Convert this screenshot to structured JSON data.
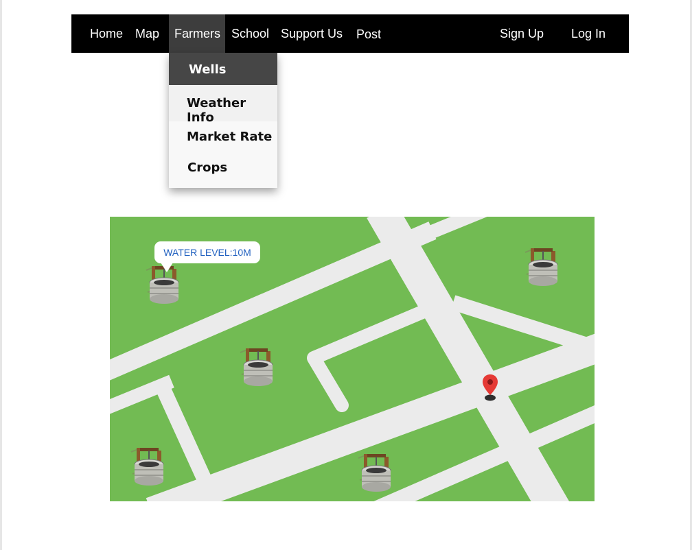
{
  "navbar": {
    "items": [
      {
        "label": "Home"
      },
      {
        "label": "Map"
      },
      {
        "label": "Farmers"
      },
      {
        "label": "School"
      },
      {
        "label": "Support Us"
      },
      {
        "label": "Post"
      }
    ],
    "right_items": [
      {
        "label": "Sign Up"
      },
      {
        "label": "Log In"
      }
    ],
    "active_item": "Farmers"
  },
  "farmers_dropdown": {
    "items": [
      {
        "label": "Wells",
        "state": "selected"
      },
      {
        "label": "Weather Info",
        "state": "hover"
      },
      {
        "label": "Market Rate",
        "state": "normal"
      },
      {
        "label": "Crops",
        "state": "normal"
      }
    ]
  },
  "map": {
    "tooltip": {
      "text": "WATER LEVEL:10M"
    },
    "wells": [
      {
        "name": "well-1"
      },
      {
        "name": "well-2"
      },
      {
        "name": "well-3"
      },
      {
        "name": "well-4"
      },
      {
        "name": "well-5"
      }
    ],
    "marker": "location-pin-icon",
    "colors": {
      "grass": "#72bb53",
      "road": "#ebebeb",
      "pin": "#e53935"
    }
  }
}
